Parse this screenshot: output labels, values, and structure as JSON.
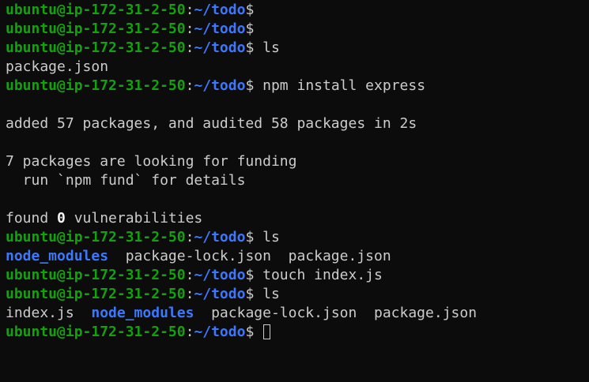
{
  "prompt": {
    "user_host": "ubuntu@ip-172-31-2-50",
    "colon": ":",
    "path": "~/todo",
    "dollar": "$"
  },
  "commands": {
    "ls1": " ls",
    "npm_install": " npm install express",
    "ls2": " ls",
    "touch": " touch index.js",
    "ls3": " ls"
  },
  "output": {
    "ls1": "package.json",
    "added": "added 57 packages, and audited 58 packages in 2s",
    "funding": "7 packages are looking for funding",
    "fund_details": "  run `npm fund` for details",
    "found_prefix": "found ",
    "found_count": "0",
    "found_suffix": " vulnerabilities",
    "ls2_dir": "node_modules",
    "ls2_rest": "  package-lock.json  package.json",
    "ls3_file": "index.js  ",
    "ls3_dir": "node_modules",
    "ls3_rest": "  package-lock.json  package.json"
  },
  "colors": {
    "background": "#0c0c0c",
    "prompt_user": "#13a10e",
    "prompt_path": "#3b78ff",
    "text": "#cccccc"
  }
}
